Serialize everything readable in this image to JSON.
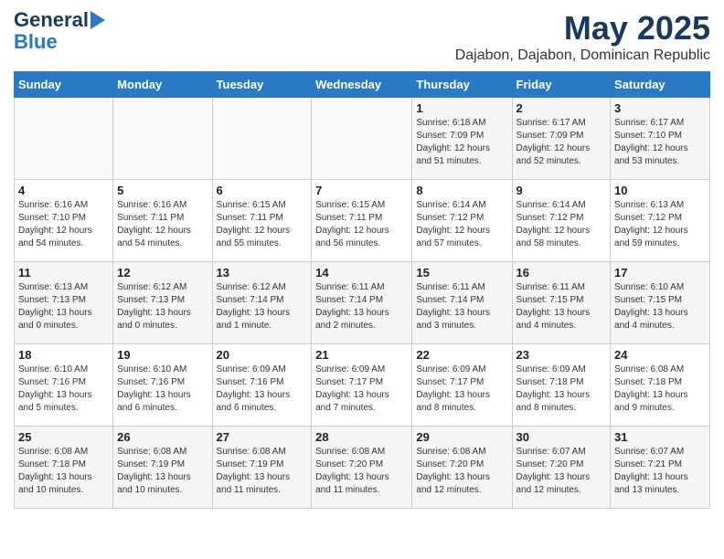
{
  "header": {
    "logo_general": "General",
    "logo_blue": "Blue",
    "title": "May 2025",
    "subtitle": "Dajabon, Dajabon, Dominican Republic"
  },
  "calendar": {
    "days_of_week": [
      "Sunday",
      "Monday",
      "Tuesday",
      "Wednesday",
      "Thursday",
      "Friday",
      "Saturday"
    ],
    "weeks": [
      [
        {
          "day": "",
          "info": ""
        },
        {
          "day": "",
          "info": ""
        },
        {
          "day": "",
          "info": ""
        },
        {
          "day": "",
          "info": ""
        },
        {
          "day": "1",
          "info": "Sunrise: 6:18 AM\nSunset: 7:09 PM\nDaylight: 12 hours\nand 51 minutes."
        },
        {
          "day": "2",
          "info": "Sunrise: 6:17 AM\nSunset: 7:09 PM\nDaylight: 12 hours\nand 52 minutes."
        },
        {
          "day": "3",
          "info": "Sunrise: 6:17 AM\nSunset: 7:10 PM\nDaylight: 12 hours\nand 53 minutes."
        }
      ],
      [
        {
          "day": "4",
          "info": "Sunrise: 6:16 AM\nSunset: 7:10 PM\nDaylight: 12 hours\nand 54 minutes."
        },
        {
          "day": "5",
          "info": "Sunrise: 6:16 AM\nSunset: 7:11 PM\nDaylight: 12 hours\nand 54 minutes."
        },
        {
          "day": "6",
          "info": "Sunrise: 6:15 AM\nSunset: 7:11 PM\nDaylight: 12 hours\nand 55 minutes."
        },
        {
          "day": "7",
          "info": "Sunrise: 6:15 AM\nSunset: 7:11 PM\nDaylight: 12 hours\nand 56 minutes."
        },
        {
          "day": "8",
          "info": "Sunrise: 6:14 AM\nSunset: 7:12 PM\nDaylight: 12 hours\nand 57 minutes."
        },
        {
          "day": "9",
          "info": "Sunrise: 6:14 AM\nSunset: 7:12 PM\nDaylight: 12 hours\nand 58 minutes."
        },
        {
          "day": "10",
          "info": "Sunrise: 6:13 AM\nSunset: 7:12 PM\nDaylight: 12 hours\nand 59 minutes."
        }
      ],
      [
        {
          "day": "11",
          "info": "Sunrise: 6:13 AM\nSunset: 7:13 PM\nDaylight: 13 hours\nand 0 minutes."
        },
        {
          "day": "12",
          "info": "Sunrise: 6:12 AM\nSunset: 7:13 PM\nDaylight: 13 hours\nand 0 minutes."
        },
        {
          "day": "13",
          "info": "Sunrise: 6:12 AM\nSunset: 7:14 PM\nDaylight: 13 hours\nand 1 minute."
        },
        {
          "day": "14",
          "info": "Sunrise: 6:11 AM\nSunset: 7:14 PM\nDaylight: 13 hours\nand 2 minutes."
        },
        {
          "day": "15",
          "info": "Sunrise: 6:11 AM\nSunset: 7:14 PM\nDaylight: 13 hours\nand 3 minutes."
        },
        {
          "day": "16",
          "info": "Sunrise: 6:11 AM\nSunset: 7:15 PM\nDaylight: 13 hours\nand 4 minutes."
        },
        {
          "day": "17",
          "info": "Sunrise: 6:10 AM\nSunset: 7:15 PM\nDaylight: 13 hours\nand 4 minutes."
        }
      ],
      [
        {
          "day": "18",
          "info": "Sunrise: 6:10 AM\nSunset: 7:16 PM\nDaylight: 13 hours\nand 5 minutes."
        },
        {
          "day": "19",
          "info": "Sunrise: 6:10 AM\nSunset: 7:16 PM\nDaylight: 13 hours\nand 6 minutes."
        },
        {
          "day": "20",
          "info": "Sunrise: 6:09 AM\nSunset: 7:16 PM\nDaylight: 13 hours\nand 6 minutes."
        },
        {
          "day": "21",
          "info": "Sunrise: 6:09 AM\nSunset: 7:17 PM\nDaylight: 13 hours\nand 7 minutes."
        },
        {
          "day": "22",
          "info": "Sunrise: 6:09 AM\nSunset: 7:17 PM\nDaylight: 13 hours\nand 8 minutes."
        },
        {
          "day": "23",
          "info": "Sunrise: 6:09 AM\nSunset: 7:18 PM\nDaylight: 13 hours\nand 8 minutes."
        },
        {
          "day": "24",
          "info": "Sunrise: 6:08 AM\nSunset: 7:18 PM\nDaylight: 13 hours\nand 9 minutes."
        }
      ],
      [
        {
          "day": "25",
          "info": "Sunrise: 6:08 AM\nSunset: 7:18 PM\nDaylight: 13 hours\nand 10 minutes."
        },
        {
          "day": "26",
          "info": "Sunrise: 6:08 AM\nSunset: 7:19 PM\nDaylight: 13 hours\nand 10 minutes."
        },
        {
          "day": "27",
          "info": "Sunrise: 6:08 AM\nSunset: 7:19 PM\nDaylight: 13 hours\nand 11 minutes."
        },
        {
          "day": "28",
          "info": "Sunrise: 6:08 AM\nSunset: 7:20 PM\nDaylight: 13 hours\nand 11 minutes."
        },
        {
          "day": "29",
          "info": "Sunrise: 6:08 AM\nSunset: 7:20 PM\nDaylight: 13 hours\nand 12 minutes."
        },
        {
          "day": "30",
          "info": "Sunrise: 6:07 AM\nSunset: 7:20 PM\nDaylight: 13 hours\nand 12 minutes."
        },
        {
          "day": "31",
          "info": "Sunrise: 6:07 AM\nSunset: 7:21 PM\nDaylight: 13 hours\nand 13 minutes."
        }
      ]
    ]
  }
}
